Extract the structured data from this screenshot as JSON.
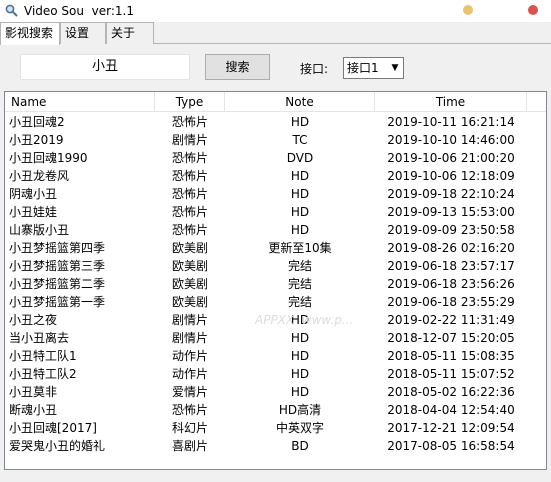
{
  "window": {
    "title": "Video Sou  ver:1.1"
  },
  "tabs": [
    {
      "label": "影视搜索"
    },
    {
      "label": "设置"
    },
    {
      "label": "关于"
    }
  ],
  "search": {
    "value": "小丑",
    "button_label": "搜索",
    "interface_label": "接口:",
    "interface_selected": "接口1"
  },
  "table": {
    "columns": [
      "Name",
      "Type",
      "Note",
      "Time"
    ],
    "rows": [
      [
        "小丑回魂2",
        "恐怖片",
        "HD",
        "2019-10-11 16:21:14"
      ],
      [
        "小丑2019",
        "剧情片",
        "TC",
        "2019-10-10 14:46:00"
      ],
      [
        "小丑回魂1990",
        "恐怖片",
        "DVD",
        "2019-10-06 21:00:20"
      ],
      [
        "小丑龙卷风",
        "恐怖片",
        "HD",
        "2019-10-06 12:18:09"
      ],
      [
        "阴魂小丑",
        "恐怖片",
        "HD",
        "2019-09-18 22:10:24"
      ],
      [
        "小丑娃娃",
        "恐怖片",
        "HD",
        "2019-09-13 15:53:00"
      ],
      [
        "山寨版小丑",
        "恐怖片",
        "HD",
        "2019-09-09 23:50:58"
      ],
      [
        "小丑梦摇篮第四季",
        "欧美剧",
        "更新至10集",
        "2019-08-26 02:16:20"
      ],
      [
        "小丑梦摇篮第三季",
        "欧美剧",
        "完结",
        "2019-06-18 23:57:17"
      ],
      [
        "小丑梦摇篮第二季",
        "欧美剧",
        "完结",
        "2019-06-18 23:56:26"
      ],
      [
        "小丑梦摇篮第一季",
        "欧美剧",
        "完结",
        "2019-06-18 23:55:29"
      ],
      [
        "小丑之夜",
        "剧情片",
        "HD",
        "2019-02-22 11:31:49"
      ],
      [
        "当小丑离去",
        "剧情片",
        "HD",
        "2018-12-07 15:20:05"
      ],
      [
        "小丑特工队1",
        "动作片",
        "HD",
        "2018-05-11 15:08:35"
      ],
      [
        "小丑特工队2",
        "动作片",
        "HD",
        "2018-05-11 15:07:52"
      ],
      [
        "小丑莫非",
        "爱情片",
        "HD",
        "2018-05-02 16:22:36"
      ],
      [
        "断魂小丑",
        "恐怖片",
        "HD高清",
        "2018-04-04 12:54:40"
      ],
      [
        "小丑回魂[2017]",
        "科幻片",
        "中英双字",
        "2017-12-21 12:09:54"
      ],
      [
        "爱哭鬼小丑的婚礼",
        "喜剧片",
        "BD",
        "2017-08-05 16:58:54"
      ]
    ]
  },
  "watermark": "APPXX  www.p..."
}
